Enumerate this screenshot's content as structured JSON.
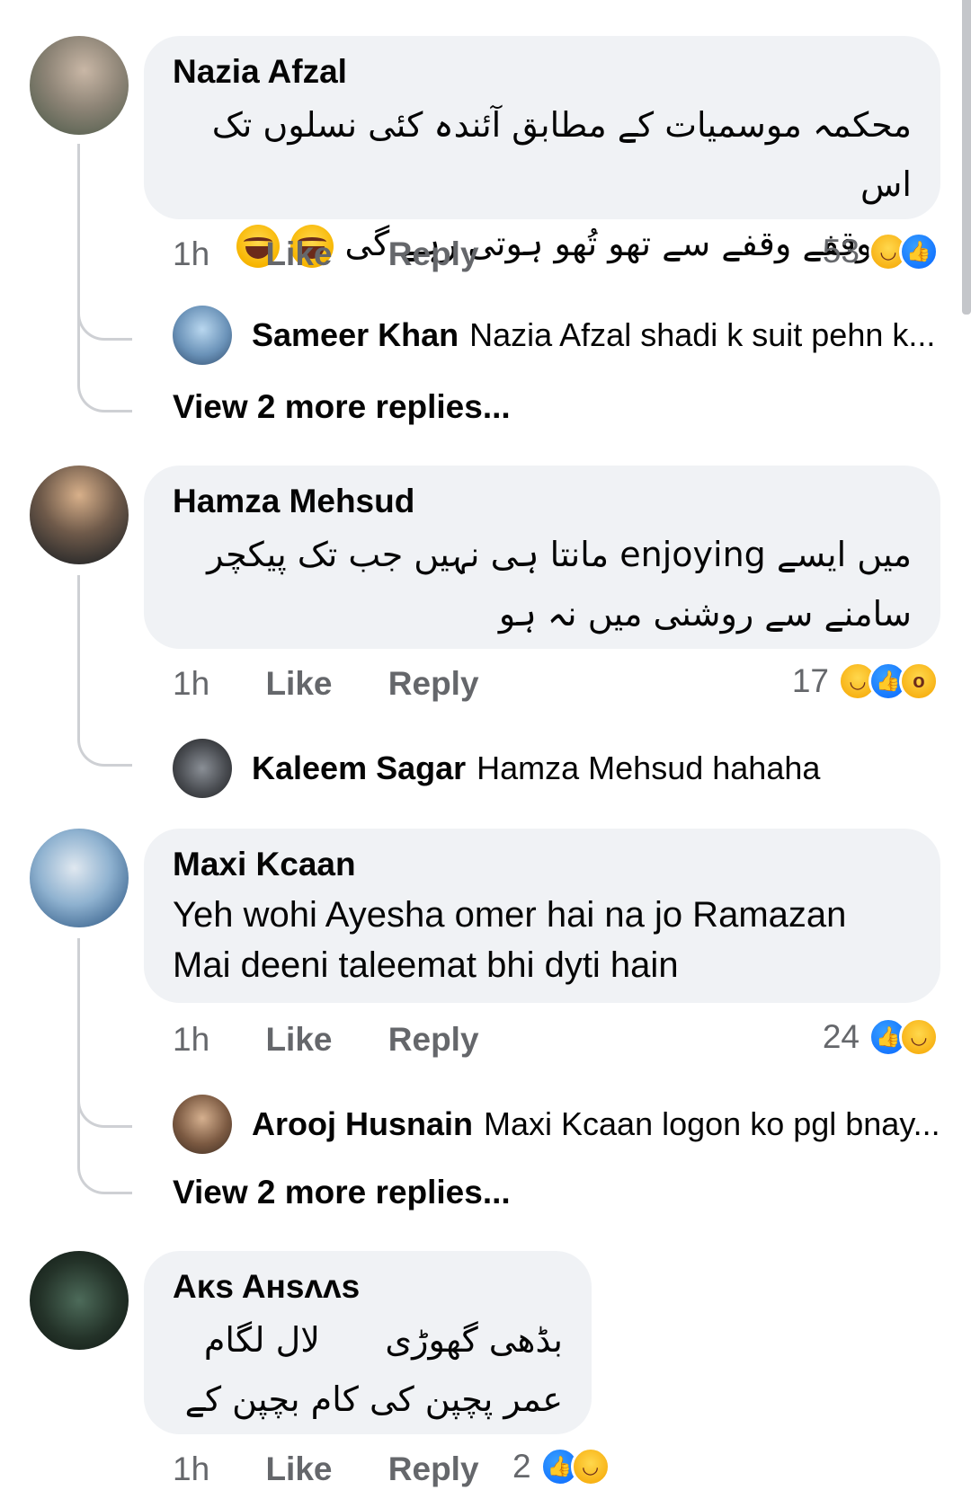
{
  "labels": {
    "like": "Like",
    "reply": "Reply"
  },
  "comments": [
    {
      "author": "Nazia Afzal",
      "text_lines": [
        "محکمہ موسمیات کے مطابق آئندہ کئی نسلوں تک اس",
        "پر وقفے وقفے سے تھو تُھو ہوتی رہے گی"
      ],
      "text_emojis": [
        "face-with-tears-of-joy",
        "face-with-tears-of-joy"
      ],
      "time": "1h",
      "reaction_count": "53",
      "reactions": [
        "haha",
        "like"
      ],
      "reply_preview": {
        "author": "Sameer Khan",
        "text": "Nazia Afzal shadi k suit pehn k..."
      },
      "more_replies": "View 2 more replies..."
    },
    {
      "author": "Hamza Mehsud",
      "text_lines": [
        "میں ایسے enjoying مانتا ہی نہیں جب تک پیکچر",
        "سامنے سے روشنی میں نہ ہو"
      ],
      "time": "1h",
      "reaction_count": "17",
      "reactions": [
        "haha",
        "like",
        "wow"
      ],
      "reply_preview": {
        "author": "Kaleem Sagar",
        "text": "Hamza Mehsud hahaha"
      }
    },
    {
      "author": "Maxi Kcaan",
      "text_lines": [
        "Yeh wohi Ayesha omer hai na jo Ramazan",
        "Mai deeni taleemat bhi dyti hain"
      ],
      "time": "1h",
      "reaction_count": "24",
      "reactions": [
        "like",
        "haha"
      ],
      "reply_preview": {
        "author": "Arooj Husnain",
        "text": "Maxi Kcaan logon ko pgl bnay..."
      },
      "more_replies": "View 2 more replies..."
    },
    {
      "author": "Aᴋs Aʜsᴧᴧs",
      "text_lines": [
        "بڈھی گھوڑی      لال لگام",
        "عمر پچپن کی کام بچپن کے"
      ],
      "time": "1h",
      "reaction_count": "2",
      "reactions": [
        "like",
        "haha"
      ]
    }
  ]
}
